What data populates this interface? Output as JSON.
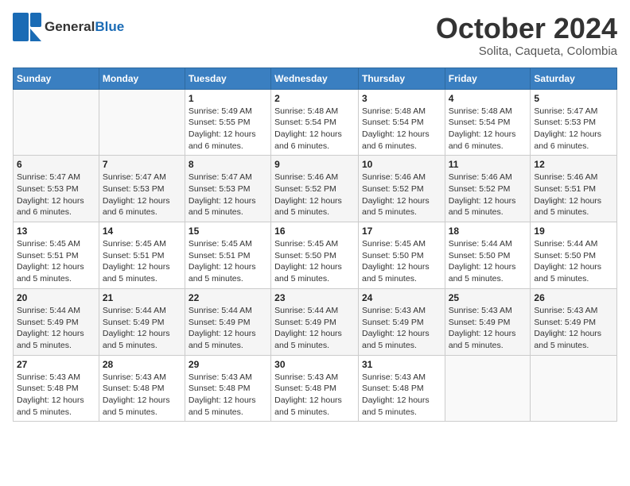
{
  "header": {
    "logo_general": "General",
    "logo_blue": "Blue",
    "title": "October 2024",
    "location": "Solita, Caqueta, Colombia"
  },
  "days_of_week": [
    "Sunday",
    "Monday",
    "Tuesday",
    "Wednesday",
    "Thursday",
    "Friday",
    "Saturday"
  ],
  "weeks": [
    [
      {
        "day": "",
        "content": ""
      },
      {
        "day": "",
        "content": ""
      },
      {
        "day": "1",
        "content": "Sunrise: 5:49 AM\nSunset: 5:55 PM\nDaylight: 12 hours\nand 6 minutes."
      },
      {
        "day": "2",
        "content": "Sunrise: 5:48 AM\nSunset: 5:54 PM\nDaylight: 12 hours\nand 6 minutes."
      },
      {
        "day": "3",
        "content": "Sunrise: 5:48 AM\nSunset: 5:54 PM\nDaylight: 12 hours\nand 6 minutes."
      },
      {
        "day": "4",
        "content": "Sunrise: 5:48 AM\nSunset: 5:54 PM\nDaylight: 12 hours\nand 6 minutes."
      },
      {
        "day": "5",
        "content": "Sunrise: 5:47 AM\nSunset: 5:53 PM\nDaylight: 12 hours\nand 6 minutes."
      }
    ],
    [
      {
        "day": "6",
        "content": "Sunrise: 5:47 AM\nSunset: 5:53 PM\nDaylight: 12 hours\nand 6 minutes."
      },
      {
        "day": "7",
        "content": "Sunrise: 5:47 AM\nSunset: 5:53 PM\nDaylight: 12 hours\nand 6 minutes."
      },
      {
        "day": "8",
        "content": "Sunrise: 5:47 AM\nSunset: 5:53 PM\nDaylight: 12 hours\nand 5 minutes."
      },
      {
        "day": "9",
        "content": "Sunrise: 5:46 AM\nSunset: 5:52 PM\nDaylight: 12 hours\nand 5 minutes."
      },
      {
        "day": "10",
        "content": "Sunrise: 5:46 AM\nSunset: 5:52 PM\nDaylight: 12 hours\nand 5 minutes."
      },
      {
        "day": "11",
        "content": "Sunrise: 5:46 AM\nSunset: 5:52 PM\nDaylight: 12 hours\nand 5 minutes."
      },
      {
        "day": "12",
        "content": "Sunrise: 5:46 AM\nSunset: 5:51 PM\nDaylight: 12 hours\nand 5 minutes."
      }
    ],
    [
      {
        "day": "13",
        "content": "Sunrise: 5:45 AM\nSunset: 5:51 PM\nDaylight: 12 hours\nand 5 minutes."
      },
      {
        "day": "14",
        "content": "Sunrise: 5:45 AM\nSunset: 5:51 PM\nDaylight: 12 hours\nand 5 minutes."
      },
      {
        "day": "15",
        "content": "Sunrise: 5:45 AM\nSunset: 5:51 PM\nDaylight: 12 hours\nand 5 minutes."
      },
      {
        "day": "16",
        "content": "Sunrise: 5:45 AM\nSunset: 5:50 PM\nDaylight: 12 hours\nand 5 minutes."
      },
      {
        "day": "17",
        "content": "Sunrise: 5:45 AM\nSunset: 5:50 PM\nDaylight: 12 hours\nand 5 minutes."
      },
      {
        "day": "18",
        "content": "Sunrise: 5:44 AM\nSunset: 5:50 PM\nDaylight: 12 hours\nand 5 minutes."
      },
      {
        "day": "19",
        "content": "Sunrise: 5:44 AM\nSunset: 5:50 PM\nDaylight: 12 hours\nand 5 minutes."
      }
    ],
    [
      {
        "day": "20",
        "content": "Sunrise: 5:44 AM\nSunset: 5:49 PM\nDaylight: 12 hours\nand 5 minutes."
      },
      {
        "day": "21",
        "content": "Sunrise: 5:44 AM\nSunset: 5:49 PM\nDaylight: 12 hours\nand 5 minutes."
      },
      {
        "day": "22",
        "content": "Sunrise: 5:44 AM\nSunset: 5:49 PM\nDaylight: 12 hours\nand 5 minutes."
      },
      {
        "day": "23",
        "content": "Sunrise: 5:44 AM\nSunset: 5:49 PM\nDaylight: 12 hours\nand 5 minutes."
      },
      {
        "day": "24",
        "content": "Sunrise: 5:43 AM\nSunset: 5:49 PM\nDaylight: 12 hours\nand 5 minutes."
      },
      {
        "day": "25",
        "content": "Sunrise: 5:43 AM\nSunset: 5:49 PM\nDaylight: 12 hours\nand 5 minutes."
      },
      {
        "day": "26",
        "content": "Sunrise: 5:43 AM\nSunset: 5:49 PM\nDaylight: 12 hours\nand 5 minutes."
      }
    ],
    [
      {
        "day": "27",
        "content": "Sunrise: 5:43 AM\nSunset: 5:48 PM\nDaylight: 12 hours\nand 5 minutes."
      },
      {
        "day": "28",
        "content": "Sunrise: 5:43 AM\nSunset: 5:48 PM\nDaylight: 12 hours\nand 5 minutes."
      },
      {
        "day": "29",
        "content": "Sunrise: 5:43 AM\nSunset: 5:48 PM\nDaylight: 12 hours\nand 5 minutes."
      },
      {
        "day": "30",
        "content": "Sunrise: 5:43 AM\nSunset: 5:48 PM\nDaylight: 12 hours\nand 5 minutes."
      },
      {
        "day": "31",
        "content": "Sunrise: 5:43 AM\nSunset: 5:48 PM\nDaylight: 12 hours\nand 5 minutes."
      },
      {
        "day": "",
        "content": ""
      },
      {
        "day": "",
        "content": ""
      }
    ]
  ]
}
